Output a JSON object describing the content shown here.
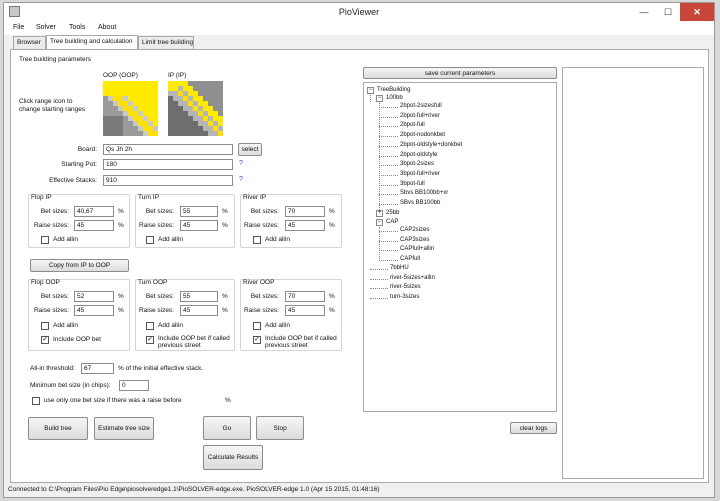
{
  "window": {
    "title": "PioViewer",
    "min": "—",
    "max": "☐",
    "close": "✕"
  },
  "menu": [
    "File",
    "Solver",
    "Tools",
    "About"
  ],
  "tabs": [
    "Browser",
    "Tree building and calculation",
    "Limit tree building"
  ],
  "params": {
    "section_title": "Tree building parameters",
    "range_hint": "Click range icon to change starting ranges",
    "oop_label": "OOP (OOP)",
    "ip_label": "IP (IP)",
    "board_label": "Board:",
    "board_value": "Qs Jh 2h",
    "select_label": "select",
    "pot_label": "Starting Pot:",
    "pot_value": "180",
    "stacks_label": "Effective Stacks:",
    "stacks_value": "910",
    "qmark": "?"
  },
  "flop_ip": {
    "title": "Flop IP",
    "bet_label": "Bet sizes:",
    "bet_value": "40,67",
    "raise_label": "Raise sizes:",
    "raise_value": "45",
    "pct": "%",
    "allin": "Add allin"
  },
  "turn_ip": {
    "title": "Turn IP",
    "bet_label": "Bet sizes:",
    "bet_value": "55",
    "raise_label": "Raise sizes:",
    "raise_value": "45",
    "pct": "%",
    "allin": "Add allin"
  },
  "river_ip": {
    "title": "River IP",
    "bet_label": "Bet sizes:",
    "bet_value": "70",
    "raise_label": "Raise sizes:",
    "raise_value": "45",
    "pct": "%",
    "allin": "Add allin"
  },
  "copy_button": "Copy from IP to OOP",
  "flop_oop": {
    "title": "Flop OOP",
    "bet_label": "Bet sizes:",
    "bet_value": "52",
    "raise_label": "Raise sizes:",
    "raise_value": "45",
    "pct": "%",
    "allin": "Add allin",
    "include": "Include OOP bet"
  },
  "turn_oop": {
    "title": "Turn OOP",
    "bet_label": "Bet sizes:",
    "bet_value": "55",
    "raise_label": "Raise sizes:",
    "raise_value": "45",
    "pct": "%",
    "allin": "Add allin",
    "include": "Include OOP bet if called previous street"
  },
  "river_oop": {
    "title": "River OOP",
    "bet_label": "Bet sizes:",
    "bet_value": "70",
    "raise_label": "Raise sizes:",
    "raise_value": "45",
    "pct": "%",
    "allin": "Add allin",
    "include": "Include OOP bet if called previous street"
  },
  "allin": {
    "label": "All-in threshold:",
    "value": "67",
    "suffix": "% of the initial effective stack."
  },
  "minbet": {
    "label": "Minimum bet size (in chips):",
    "value": "0"
  },
  "onebet": {
    "label": "use only one bet size if there was a raise before",
    "pct": "%"
  },
  "buttons": {
    "build": "Build tree",
    "estimate": "Estimate tree size",
    "go": "Go",
    "stop": "Stop",
    "calc": "Calculate Results",
    "save": "save current parameters",
    "logs": "clear logs"
  },
  "tree": {
    "root": "TreeBuilding",
    "g100": "100bb",
    "items100": [
      "2bpot-2sizesfull",
      "2bpot-full+river",
      "2bpot-full",
      "2bpot-nodonkbet",
      "2bpot-oldstyle+donkbet",
      "2bpot-oldstyle",
      "3bpot-2sizes",
      "3bpot-full+river",
      "3bpot-full",
      "Sbvs BB100bb+xr",
      "SBvs BB100bb"
    ],
    "g25": "25bb",
    "gcap": "CAP",
    "itemscap": [
      "CAP2sizes",
      "CAP3sizes",
      "CAPfull+allin",
      "CAPfull"
    ],
    "rest": [
      "7bbHU",
      "river-5sizes+allin",
      "river-5sizes",
      "turn-3sizes"
    ],
    "minus": "−",
    "plus": "+"
  },
  "status": "Connected to C:\\Program Files\\Pio Edge\\piosolveredge1.1\\PioSOLVER-edge.exe. PioSOLVER-edge 1.0 (Apr 15 2015, 01:48:16)"
}
